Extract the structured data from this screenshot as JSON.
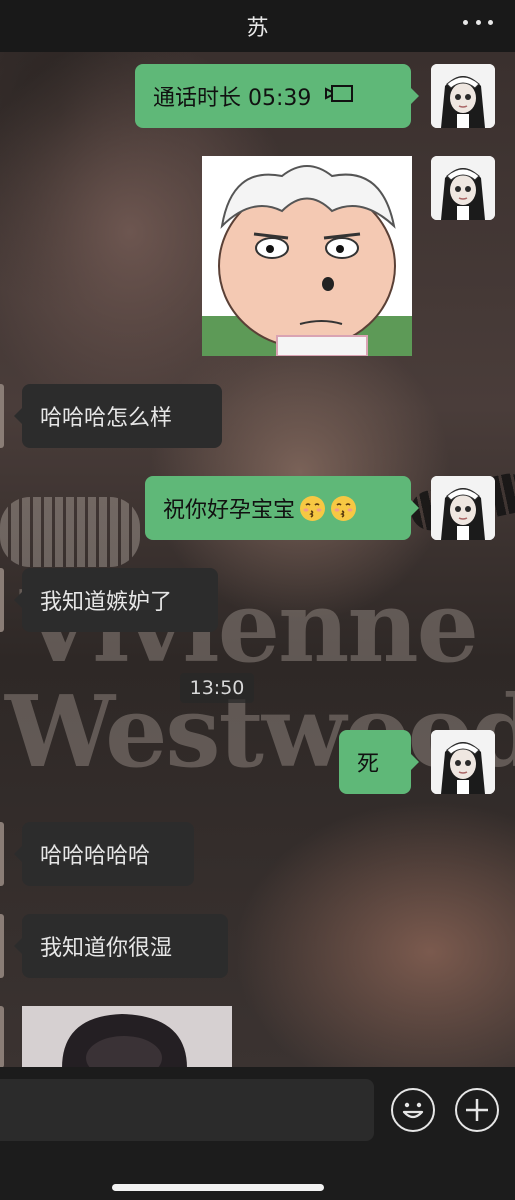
{
  "header": {
    "title": "苏",
    "more_icon": "more-dots-icon"
  },
  "messages": {
    "call": {
      "label": "通话时长 05:39",
      "icon": "video-call-icon"
    },
    "greet": {
      "text": "哈哈哈怎么样"
    },
    "wish": {
      "text": "祝你好孕宝宝",
      "emoji": "kissing-face-emoji"
    },
    "jealous": {
      "text": "我知道嫉妒了"
    },
    "dead": {
      "text": "死"
    },
    "laugh": {
      "text": "哈哈哈哈哈"
    },
    "wet": {
      "text": "我知道你很湿"
    }
  },
  "timestamp": "13:50",
  "watermark": {
    "line1": "Vivienne",
    "line2": "Westwood"
  },
  "input": {
    "placeholder": ""
  },
  "colors": {
    "my_bubble": "#5fb878",
    "other_bubble": "#2c2c2c",
    "header_bg": "#191919"
  }
}
